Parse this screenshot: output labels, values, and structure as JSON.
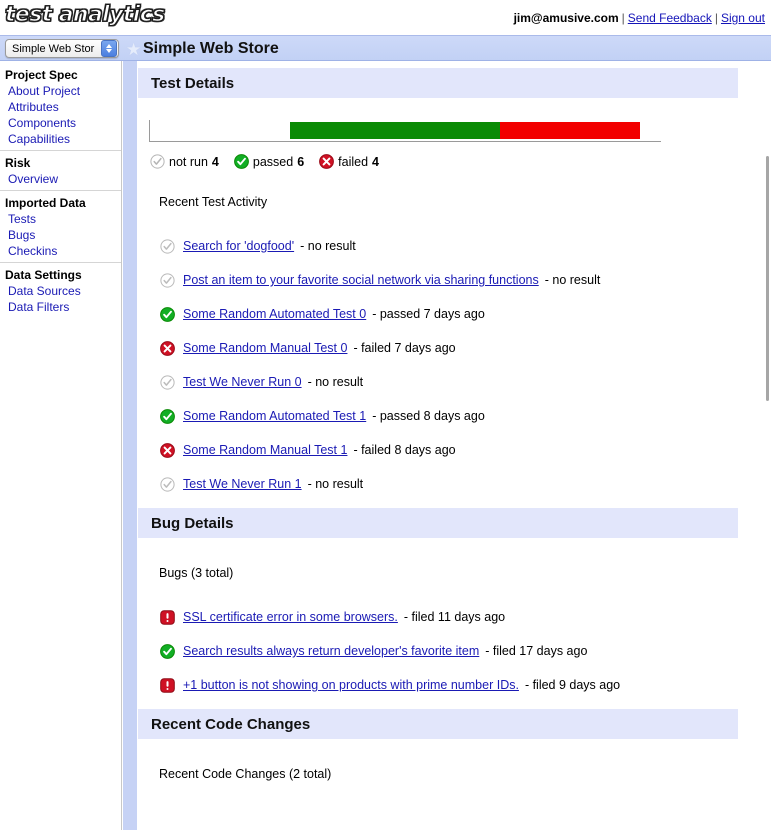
{
  "app": {
    "logo": "test analytics"
  },
  "account": {
    "email": "jim@amusive.com",
    "feedback_label": "Send Feedback",
    "signout_label": "Sign out",
    "separator": "|"
  },
  "project_bar": {
    "select_value": "Simple Web Stor",
    "star_icon": "star-icon",
    "title": "Simple Web Store"
  },
  "sidebar": {
    "groups": [
      {
        "heading": "Project Spec",
        "items": [
          {
            "label": "About Project"
          },
          {
            "label": "Attributes"
          },
          {
            "label": "Components"
          },
          {
            "label": "Capabilities"
          }
        ]
      },
      {
        "heading": "Risk",
        "items": [
          {
            "label": "Overview"
          }
        ]
      },
      {
        "heading": "Imported Data",
        "items": [
          {
            "label": "Tests"
          },
          {
            "label": "Bugs"
          },
          {
            "label": "Checkins"
          }
        ]
      },
      {
        "heading": "Data Settings",
        "items": [
          {
            "label": "Data Sources"
          },
          {
            "label": "Data Filters"
          }
        ]
      }
    ]
  },
  "test_details": {
    "heading": "Test Details",
    "chart_data": {
      "type": "bar",
      "title": "Test Details",
      "categories": [
        "not run",
        "passed",
        "failed"
      ],
      "values": [
        4,
        6,
        4
      ],
      "colors": [
        "#ffffff",
        "#0a8a05",
        "#f20000"
      ],
      "total": 14,
      "xlabel": "",
      "ylabel": "",
      "legend_position": "below"
    },
    "legend": {
      "not_run_label": "not run",
      "not_run_count": "4",
      "passed_label": "passed",
      "passed_count": "6",
      "failed_label": "failed",
      "failed_count": "4"
    },
    "activity_heading": "Recent Test Activity",
    "items": [
      {
        "status": "notrun",
        "name": "Search for 'dogfood'",
        "meta": "- no result"
      },
      {
        "status": "notrun",
        "name": "Post an item to your favorite social network via sharing functions",
        "meta": "- no result"
      },
      {
        "status": "passed",
        "name": "Some Random Automated Test 0",
        "meta": "- passed 7 days ago"
      },
      {
        "status": "failed",
        "name": "Some Random Manual Test 0",
        "meta": "- failed 7 days ago"
      },
      {
        "status": "notrun",
        "name": "Test We Never Run 0",
        "meta": "- no result"
      },
      {
        "status": "passed",
        "name": "Some Random Automated Test 1",
        "meta": "- passed 8 days ago"
      },
      {
        "status": "failed",
        "name": "Some Random Manual Test 1",
        "meta": "- failed 8 days ago"
      },
      {
        "status": "notrun",
        "name": "Test We Never Run 1",
        "meta": "- no result"
      }
    ]
  },
  "bug_details": {
    "heading": "Bug Details",
    "summary": "Bugs (3 total)",
    "items": [
      {
        "status": "open",
        "name": "SSL certificate error in some browsers.",
        "meta": "- filed 11 days ago"
      },
      {
        "status": "fixed",
        "name": "Search results always return developer's favorite item",
        "meta": "- filed 17 days ago"
      },
      {
        "status": "open",
        "name": "+1 button is not showing on products with prime number IDs.",
        "meta": "- filed 9 days ago"
      }
    ]
  },
  "code_changes": {
    "heading": "Recent Code Changes",
    "summary": "Recent Code Changes (2 total)"
  },
  "colors": {
    "accent_blue": "#c6d2f5",
    "header_band": "#e2e6fb",
    "link": "#1a1ab4",
    "pass_green": "#0a8a05",
    "fail_red": "#f20000"
  }
}
